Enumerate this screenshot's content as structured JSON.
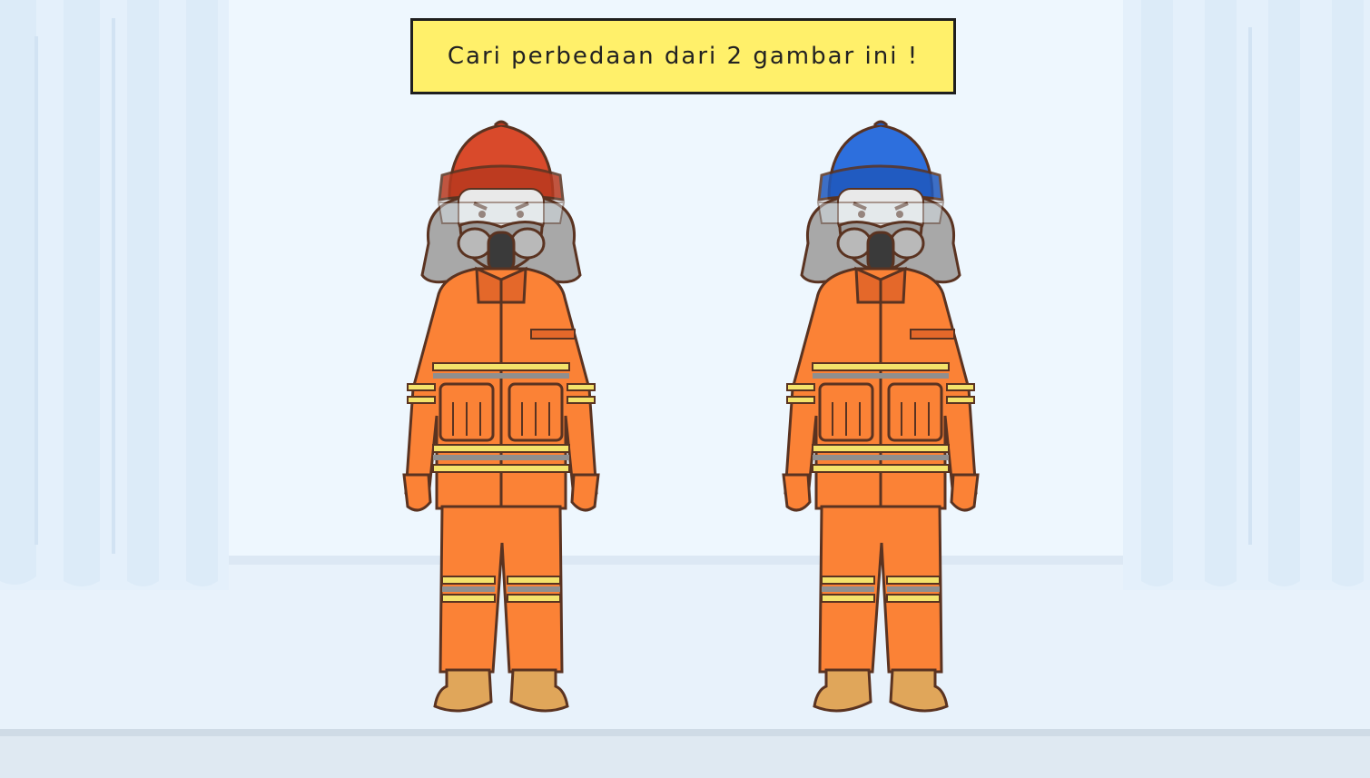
{
  "instruction": {
    "text": "Cari perbedaan dari 2 gambar ini !"
  },
  "figures": [
    {
      "id": "firefighter-left",
      "helmet_color": "#d94a2b",
      "helmet_dark": "#b9391f",
      "helmet_label": "red-helmet"
    },
    {
      "id": "firefighter-right",
      "helmet_color": "#2d6fdd",
      "helmet_dark": "#1f58bd",
      "helmet_label": "blue-helmet"
    }
  ],
  "colors": {
    "suit": "#fb8236",
    "suit_dark": "#e4682a",
    "reflective_stripe": "#f4e36b",
    "stripe_gray": "#8f8f8f",
    "boots": "#e0a65a",
    "outline": "#5a3321",
    "hood_gray": "#a8a8a8",
    "mask_dark": "#3a3a3a"
  }
}
